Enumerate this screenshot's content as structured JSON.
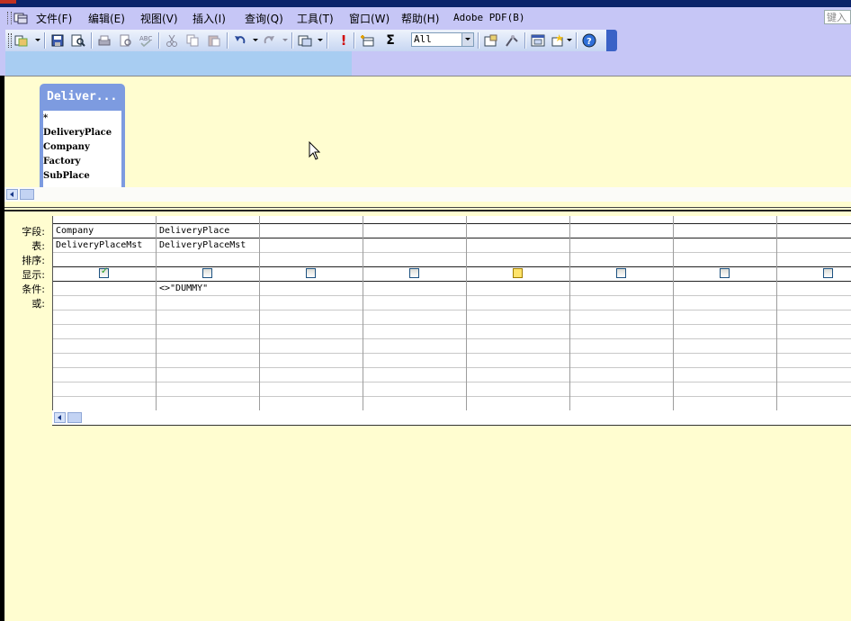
{
  "menu": {
    "items": [
      "文件(F)",
      "编辑(E)",
      "视图(V)",
      "插入(I)",
      "查询(Q)",
      "工具(T)",
      "窗口(W)",
      "帮助(H)",
      "Adobe PDF(B)"
    ],
    "ask_placeholder": "键入"
  },
  "toolbar": {
    "icons": [
      "view-icon",
      "save-icon",
      "search-icon",
      "print-icon",
      "print-preview-icon",
      "spelling-icon",
      "cut-icon",
      "copy-icon",
      "paste-icon",
      "undo-icon",
      "redo-icon",
      "query-type-icon",
      "run-icon",
      "show-table-icon",
      "totals-icon",
      "properties-icon",
      "build-icon",
      "database-window-icon",
      "new-object-icon",
      "help-icon"
    ],
    "top_values_combo": "All",
    "totals_symbol": "Σ",
    "run_symbol": "!"
  },
  "table_box": {
    "title": "Deliver...",
    "fields": [
      "*",
      "DeliveryPlace",
      "Company",
      "Factory",
      "SubPlace"
    ]
  },
  "grid": {
    "row_labels": [
      "字段:",
      "表:",
      "排序:",
      "显示:",
      "条件:",
      "或:"
    ],
    "columns": [
      {
        "field": "Company",
        "table": "DeliveryPlaceMst",
        "show": true,
        "criteria": ""
      },
      {
        "field": "DeliveryPlace",
        "table": "DeliveryPlaceMst",
        "show": false,
        "criteria": "<>\"DUMMY\""
      },
      {
        "field": "",
        "table": "",
        "show": false,
        "criteria": ""
      },
      {
        "field": "",
        "table": "",
        "show": false,
        "criteria": ""
      },
      {
        "field": "",
        "table": "",
        "show": false,
        "criteria": ""
      },
      {
        "field": "",
        "table": "",
        "show": false,
        "criteria": ""
      },
      {
        "field": "",
        "table": "",
        "show": false,
        "criteria": ""
      },
      {
        "field": "",
        "table": "",
        "show": false,
        "criteria": ""
      }
    ]
  }
}
